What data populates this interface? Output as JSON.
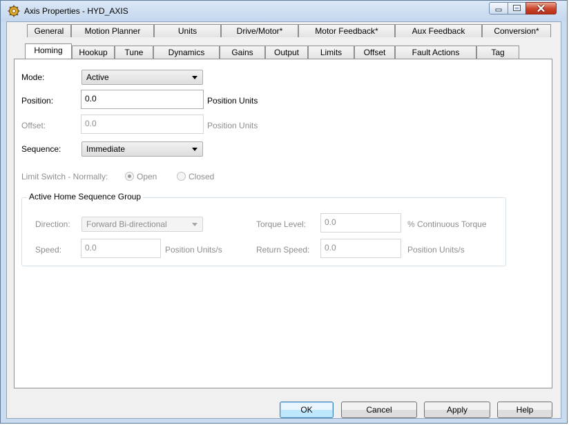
{
  "window": {
    "title": "Axis Properties - HYD_AXIS"
  },
  "tabs_row1": [
    "General",
    "Motion Planner",
    "Units",
    "Drive/Motor*",
    "Motor Feedback*",
    "Aux Feedback",
    "Conversion*"
  ],
  "tabs_row2": [
    "Homing",
    "Hookup",
    "Tune",
    "Dynamics",
    "Gains",
    "Output",
    "Limits",
    "Offset",
    "Fault Actions",
    "Tag"
  ],
  "active_tab": "Homing",
  "homing": {
    "mode_label": "Mode:",
    "mode_value": "Active",
    "position_label": "Position:",
    "position_value": "0.0",
    "position_units": "Position Units",
    "offset_label": "Offset:",
    "offset_value": "0.0",
    "offset_units": "Position Units",
    "sequence_label": "Sequence:",
    "sequence_value": "Immediate",
    "limit_switch_label": "Limit Switch - Normally:",
    "limit_open": "Open",
    "limit_closed": "Closed",
    "limit_selected": "Open"
  },
  "group": {
    "title": "Active Home Sequence Group",
    "direction_label": "Direction:",
    "direction_value": "Forward Bi-directional",
    "torque_label": "Torque Level:",
    "torque_value": "0.0",
    "torque_units": "% Continuous Torque",
    "speed_label": "Speed:",
    "speed_value": "0.0",
    "speed_units": "Position Units/s",
    "return_speed_label": "Return Speed:",
    "return_speed_value": "0.0",
    "return_speed_units": "Position Units/s"
  },
  "buttons": {
    "ok": "OK",
    "cancel": "Cancel",
    "apply": "Apply",
    "help": "Help"
  },
  "icons": {
    "app": "gear-icon",
    "minimize": "minimize-icon",
    "maximize": "maximize-icon",
    "close": "close-icon",
    "dropdown": "chevron-down-icon"
  },
  "colors": {
    "title_bar": "#c4d7ee",
    "close_button": "#c9432a",
    "disabled_text": "#8d8d8d"
  }
}
